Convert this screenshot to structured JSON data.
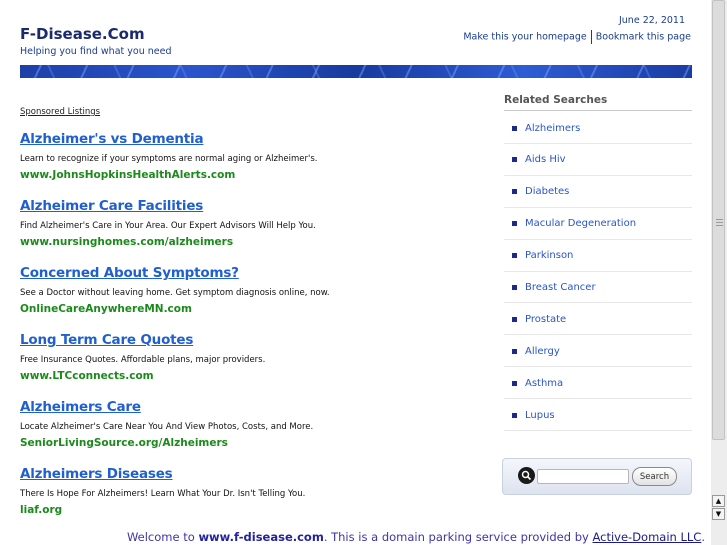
{
  "header": {
    "site_title": "F-Disease.Com",
    "tagline": "Helping you find what you need",
    "date": "June 22, 2011",
    "make_homepage": "Make this your homepage",
    "bookmark": "Bookmark this page"
  },
  "sponsored_label": "Sponsored Listings",
  "listings": [
    {
      "title": "Alzheimer's vs Dementia",
      "desc": "Learn to recognize if your symptoms are normal aging or Alzheimer's.",
      "url": "www.JohnsHopkinsHealthAlerts.com"
    },
    {
      "title": "Alzheimer Care Facilities",
      "desc": "Find Alzheimer's Care in Your Area. Our Expert Advisors Will Help You.",
      "url": "www.nursinghomes.com/alzheimers"
    },
    {
      "title": "Concerned About Symptoms?",
      "desc": "See a Doctor without leaving home. Get symptom diagnosis online, now.",
      "url": "OnlineCareAnywhereMN.com"
    },
    {
      "title": "Long Term Care Quotes",
      "desc": "Free Insurance Quotes. Affordable plans, major providers.",
      "url": "www.LTCconnects.com"
    },
    {
      "title": "Alzheimers Care",
      "desc": "Locate Alzheimer's Care Near You And View Photos, Costs, and More.",
      "url": "SeniorLivingSource.org/Alzheimers"
    },
    {
      "title": "Alzheimers Diseases",
      "desc": "There Is Hope For Alzheimers! Learn What Your Dr. Isn't Telling You.",
      "url": "liaf.org"
    }
  ],
  "related": {
    "heading": "Related Searches",
    "items": [
      "Alzheimers",
      "Aids Hiv",
      "Diabetes",
      "Macular Degeneration",
      "Parkinson",
      "Breast Cancer",
      "Prostate",
      "Allergy",
      "Asthma",
      "Lupus"
    ]
  },
  "search": {
    "button_label": "Search",
    "value": ""
  },
  "footer": {
    "prefix": "Welcome to ",
    "site": "www.f-disease.com",
    "middle": ". This is a domain parking service provided by ",
    "provider": "Active-Domain LLC",
    "suffix": "."
  },
  "colors": {
    "title": "#1a2a6c",
    "link": "#1f5fcf",
    "url_green": "#1b8a1b",
    "banner": "#1d3fa8"
  }
}
